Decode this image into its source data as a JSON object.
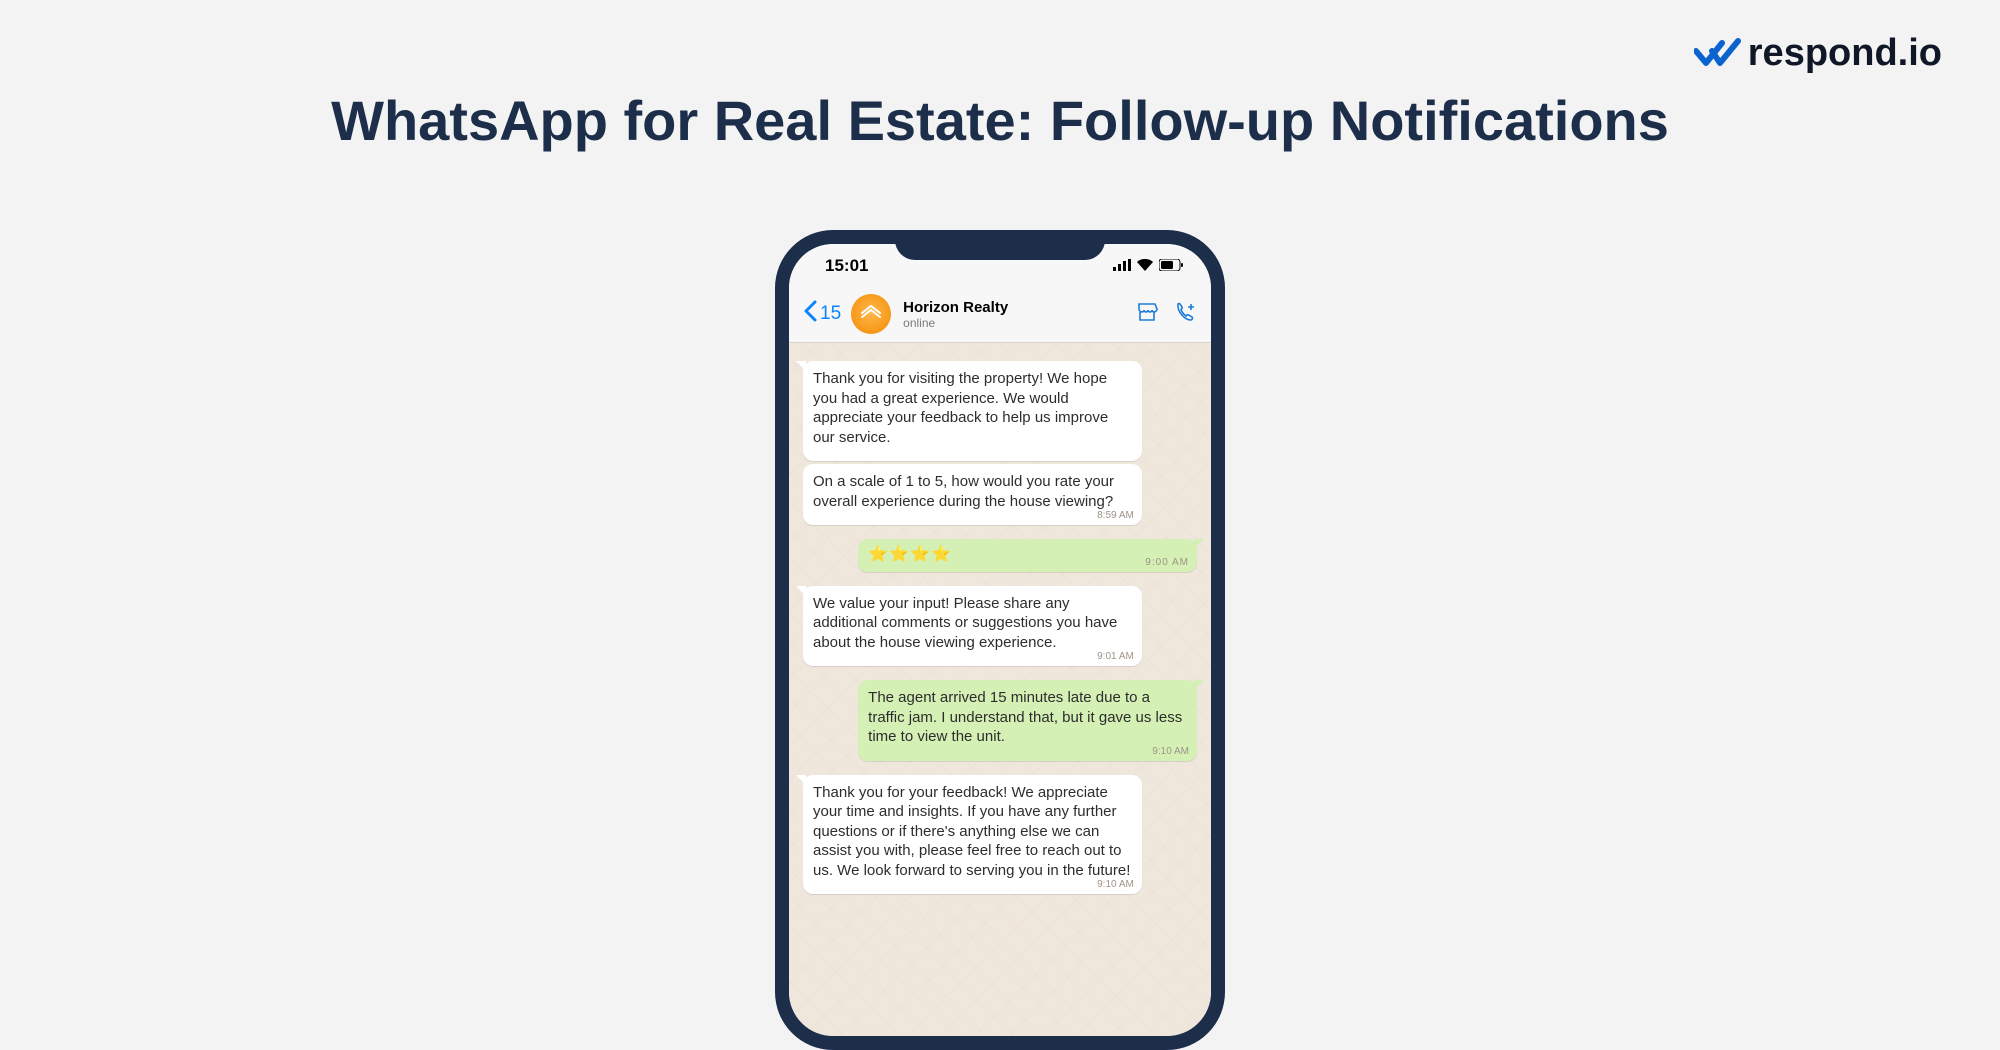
{
  "brand": {
    "name": "respond.io"
  },
  "page": {
    "title": "WhatsApp for Real Estate: Follow-up Notifications"
  },
  "status_bar": {
    "time": "15:01"
  },
  "header": {
    "back_count": "15",
    "contact_name": "Horizon Realty",
    "status": "online"
  },
  "messages": {
    "m1": {
      "text": "Thank you for visiting the property! We hope you had a great experience. We would appreciate your feedback to help us improve our service."
    },
    "m2": {
      "text": "On a scale of 1 to 5, how would you rate your overall experience during the house viewing?",
      "time": "8:59 AM"
    },
    "m3": {
      "text": "⭐⭐⭐⭐",
      "time": "9:00 AM"
    },
    "m4": {
      "text": "We value your input! Please share any additional comments or suggestions you have about the house viewing experience.",
      "time": "9:01 AM"
    },
    "m5": {
      "text": "The agent arrived 15 minutes late due to a traffic jam. I understand that, but it gave us less time to view the unit.",
      "time": "9:10 AM"
    },
    "m6": {
      "text": "Thank you for your feedback! We appreciate your time and insights. If you have any further questions or if there's anything else we can assist you with, please feel free to reach out to us. We look forward to serving you in the future!",
      "time": "9:10 AM"
    }
  }
}
